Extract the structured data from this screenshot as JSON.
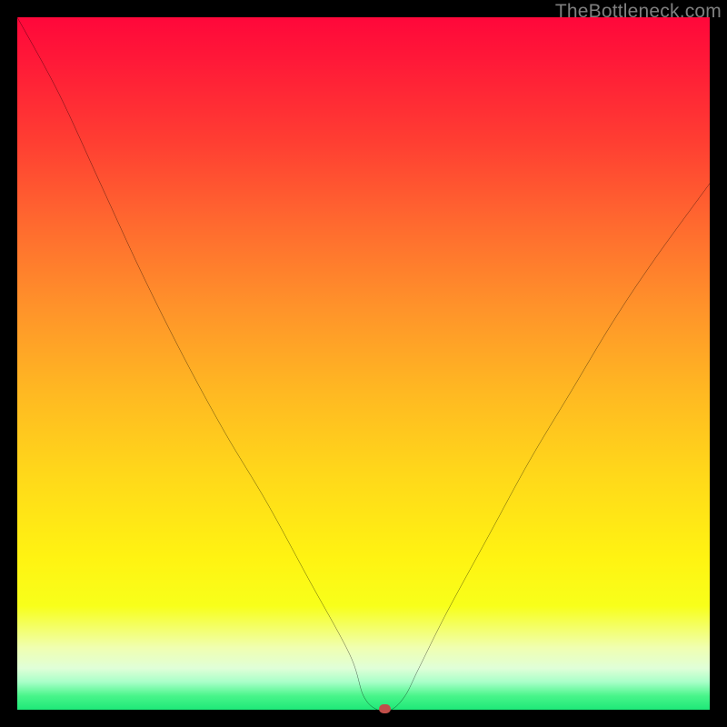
{
  "watermark": "TheBottleneck.com",
  "chart_data": {
    "type": "line",
    "title": "",
    "xlabel": "",
    "ylabel": "",
    "xlim": [
      0,
      100
    ],
    "ylim": [
      0,
      100
    ],
    "grid": false,
    "legend": false,
    "series": [
      {
        "name": "bottleneck-curve",
        "x": [
          0,
          6,
          12,
          18,
          24,
          30,
          36,
          42,
          48,
          50,
          52,
          54,
          56,
          58,
          62,
          68,
          74,
          80,
          86,
          92,
          100
        ],
        "values": [
          100,
          89,
          76,
          63,
          51,
          40,
          30,
          19,
          8,
          2,
          0,
          0,
          2,
          6,
          14,
          25,
          36,
          46,
          56,
          65,
          76
        ]
      }
    ],
    "marker": {
      "x": 53,
      "y": 0,
      "color": "#c14f4a"
    },
    "background_gradient": {
      "top": "#ff073a",
      "bottom": "#1ee878"
    }
  }
}
